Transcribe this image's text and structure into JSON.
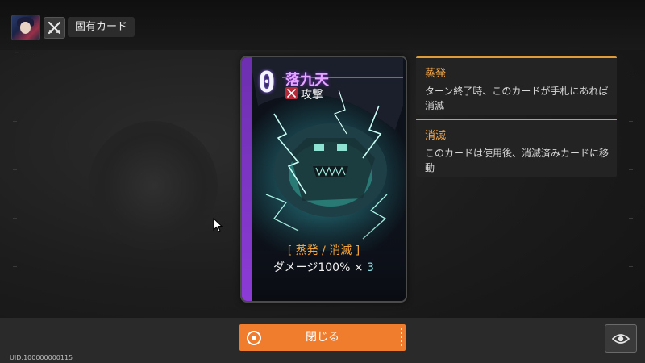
{
  "header": {
    "tab_label": "固有カード",
    "avatar_icon": "character-portrait",
    "mode_icon": "crossed-swords-icon"
  },
  "card": {
    "cost": "0",
    "name": "落九天",
    "type_icon": "crossed-swords-icon",
    "type": "攻撃",
    "keywords": "[ 蒸発 / 消滅 ]",
    "effect_prefix": "ダメージ100% × ",
    "effect_hits": "3",
    "accent_color": "#8c3bd6"
  },
  "keyword_tooltips": [
    {
      "title": "蒸発",
      "description": "ターン終了時、このカードが手札にあれば消滅"
    },
    {
      "title": "消滅",
      "description": "このカードは使用後、消滅済みカードに移動"
    }
  ],
  "footer": {
    "close_label": "閉じる",
    "close_color": "#f07d2e",
    "eye_icon": "eye-icon",
    "uid": "UID:100000000115"
  }
}
